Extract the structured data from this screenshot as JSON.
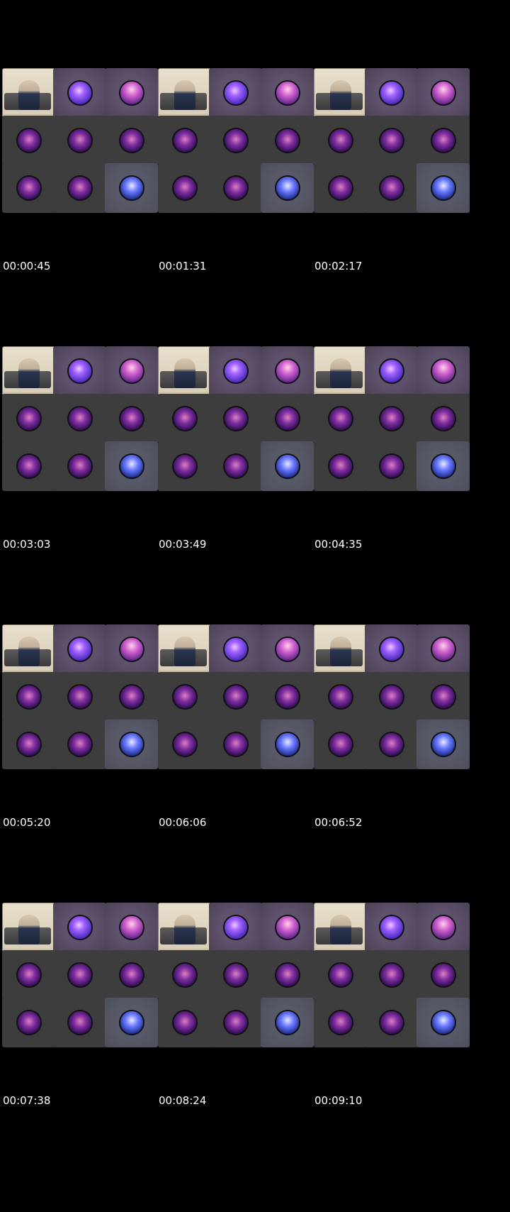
{
  "timestamps": [
    "00:00:45",
    "00:01:31",
    "00:02:17",
    "00:03:03",
    "00:03:49",
    "00:04:35",
    "00:05:20",
    "00:06:06",
    "00:06:52",
    "00:07:38",
    "00:08:24",
    "00:09:10"
  ],
  "tile_layout": [
    [
      "cam",
      "purple:violet",
      "purple:pink"
    ],
    [
      "grey:dark",
      "grey:dark",
      "grey:dark"
    ],
    [
      "grey:dark",
      "grey:dark",
      "bluish:blue"
    ]
  ],
  "colors": {
    "background": "#000000",
    "tile_grey": "#3d3d3d",
    "tile_purple": "#564a62",
    "timestamp_text": "#ffffff"
  }
}
